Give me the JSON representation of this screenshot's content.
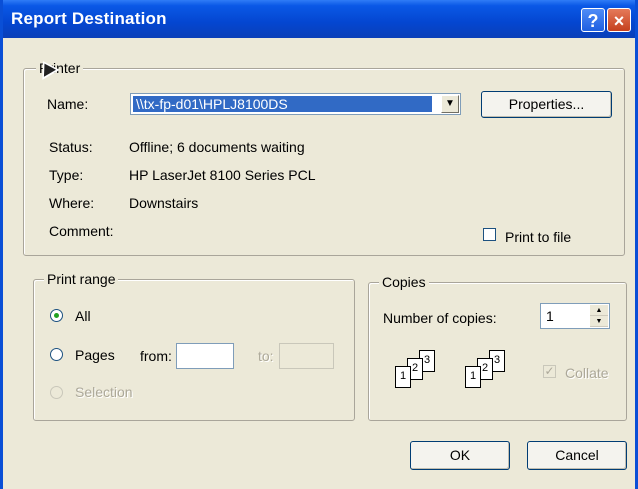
{
  "window": {
    "title": "Report Destination",
    "help_glyph": "?",
    "close_glyph": "×"
  },
  "printer": {
    "group_label": "Printer",
    "name_label": "Name:",
    "name_value": "\\\\tx-fp-d01\\HPLJ8100DS",
    "properties_label": "Properties...",
    "status_label": "Status:",
    "status_value": "Offline; 6 documents waiting",
    "type_label": "Type:",
    "type_value": "HP LaserJet 8100 Series PCL",
    "where_label": "Where:",
    "where_value": "Downstairs",
    "comment_label": "Comment:",
    "print_to_file_label": "Print to file"
  },
  "print_range": {
    "group_label": "Print range",
    "all_label": "All",
    "pages_label": "Pages",
    "from_label": "from:",
    "to_label": "to:",
    "selection_label": "Selection",
    "selected": "All"
  },
  "copies": {
    "group_label": "Copies",
    "number_label": "Number of copies:",
    "number_value": "1",
    "collate_label": "Collate",
    "pages_a": [
      "1",
      "2",
      "3"
    ],
    "pages_b": [
      "1",
      "2",
      "3"
    ]
  },
  "buttons": {
    "ok_label": "OK",
    "cancel_label": "Cancel"
  }
}
